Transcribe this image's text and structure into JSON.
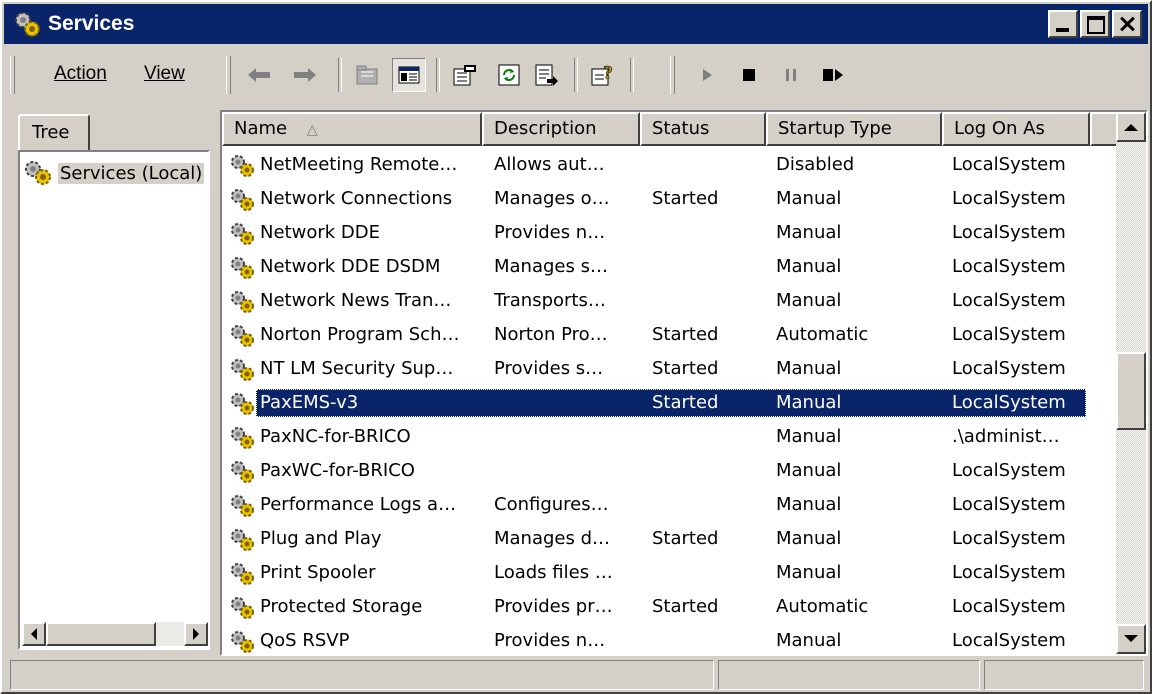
{
  "window": {
    "title": "Services"
  },
  "menu": {
    "action": "Action",
    "view": "View"
  },
  "toolbar": {
    "buttons": [
      "back-icon",
      "forward-icon",
      "up-folder-icon",
      "show-tree-icon",
      "properties-icon",
      "refresh-icon",
      "export-list-icon",
      "help-icon",
      "start-service-icon",
      "stop-service-icon",
      "pause-service-icon",
      "restart-service-icon"
    ]
  },
  "tree": {
    "tab_label": "Tree",
    "root_label": "Services (Local)"
  },
  "list": {
    "columns": [
      "Name",
      "Description",
      "Status",
      "Startup Type",
      "Log On As"
    ],
    "sort_indicator": "△",
    "selected_index": 7,
    "rows": [
      {
        "name": "NetMeeting Remote…",
        "description": "Allows aut…",
        "status": "",
        "startup": "Disabled",
        "logon": "LocalSystem"
      },
      {
        "name": "Network Connections",
        "description": "Manages o…",
        "status": "Started",
        "startup": "Manual",
        "logon": "LocalSystem"
      },
      {
        "name": "Network DDE",
        "description": "Provides n…",
        "status": "",
        "startup": "Manual",
        "logon": "LocalSystem"
      },
      {
        "name": "Network DDE DSDM",
        "description": "Manages s…",
        "status": "",
        "startup": "Manual",
        "logon": "LocalSystem"
      },
      {
        "name": "Network News Tran…",
        "description": "Transports…",
        "status": "",
        "startup": "Manual",
        "logon": "LocalSystem"
      },
      {
        "name": "Norton Program Sch…",
        "description": "Norton Pro…",
        "status": "Started",
        "startup": "Automatic",
        "logon": "LocalSystem"
      },
      {
        "name": "NT LM Security Sup…",
        "description": "Provides s…",
        "status": "Started",
        "startup": "Manual",
        "logon": "LocalSystem"
      },
      {
        "name": "PaxEMS-v3",
        "description": "",
        "status": "Started",
        "startup": "Manual",
        "logon": "LocalSystem"
      },
      {
        "name": "PaxNC-for-BRICO",
        "description": "",
        "status": "",
        "startup": "Manual",
        "logon": ".\\administ…"
      },
      {
        "name": "PaxWC-for-BRICO",
        "description": "",
        "status": "",
        "startup": "Manual",
        "logon": "LocalSystem"
      },
      {
        "name": "Performance Logs a…",
        "description": "Configures…",
        "status": "",
        "startup": "Manual",
        "logon": "LocalSystem"
      },
      {
        "name": "Plug and Play",
        "description": "Manages d…",
        "status": "Started",
        "startup": "Manual",
        "logon": "LocalSystem"
      },
      {
        "name": "Print Spooler",
        "description": "Loads files …",
        "status": "",
        "startup": "Manual",
        "logon": "LocalSystem"
      },
      {
        "name": "Protected Storage",
        "description": "Provides pr…",
        "status": "Started",
        "startup": "Automatic",
        "logon": "LocalSystem"
      },
      {
        "name": "QoS RSVP",
        "description": "Provides n…",
        "status": "",
        "startup": "Manual",
        "logon": "LocalSystem"
      }
    ]
  },
  "statusbar": {
    "panels": [
      "",
      "",
      ""
    ]
  },
  "colors": {
    "titlebar": "#0a246a",
    "selection": "#0a246a",
    "face": "#d4d0c8"
  }
}
